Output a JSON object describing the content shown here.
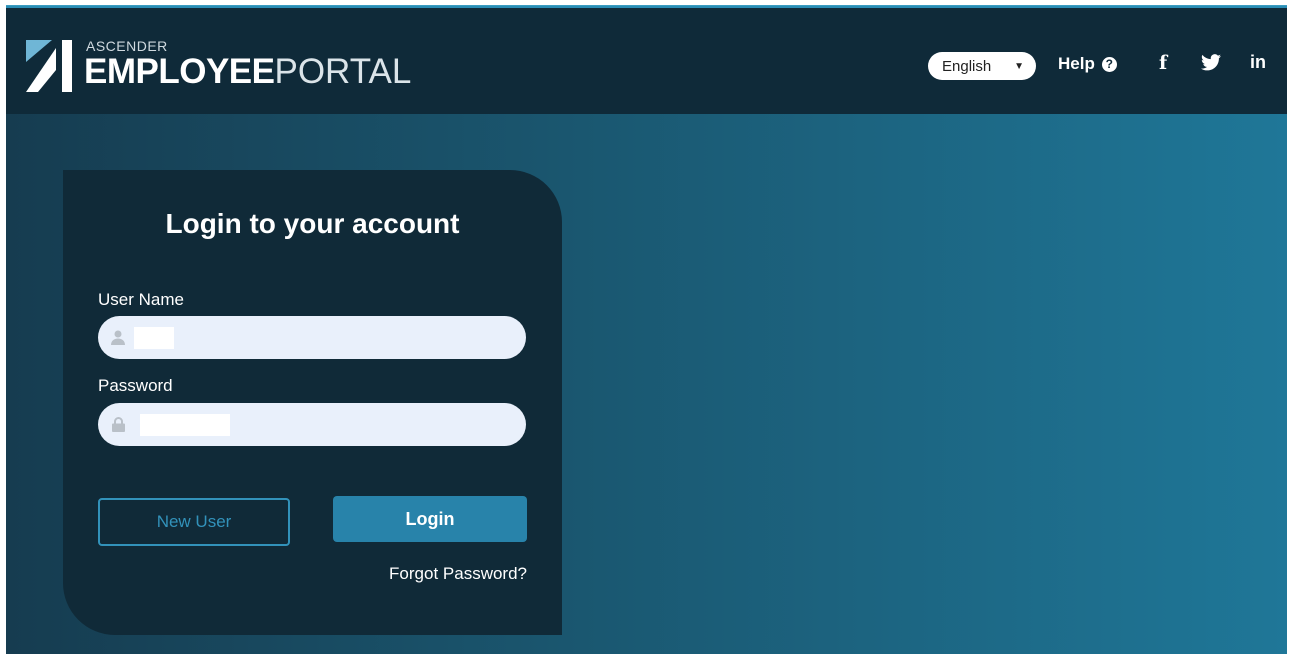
{
  "header": {
    "logo_small": "ASCENDER",
    "logo_bold": "EMPLOYEE",
    "logo_light": "PORTAL",
    "language": {
      "selected": "English",
      "caret_icon": "triangle-down"
    },
    "help_label": "Help",
    "help_icon": "question-circle",
    "social": [
      {
        "name": "facebook",
        "glyph": "f"
      },
      {
        "name": "twitter",
        "glyph": "bird"
      },
      {
        "name": "linkedin",
        "glyph": "in"
      }
    ]
  },
  "login": {
    "title": "Login to your account",
    "username_label": "User Name",
    "username_value": "",
    "password_label": "Password",
    "password_value": "",
    "new_user_label": "New User",
    "login_label": "Login",
    "forgot_label": "Forgot Password?"
  },
  "colors": {
    "header_bg": "#0f2a39",
    "card_bg": "#102a38",
    "accent": "#2883aa",
    "bg_left": "#163c50",
    "bg_right": "#1f7798"
  }
}
